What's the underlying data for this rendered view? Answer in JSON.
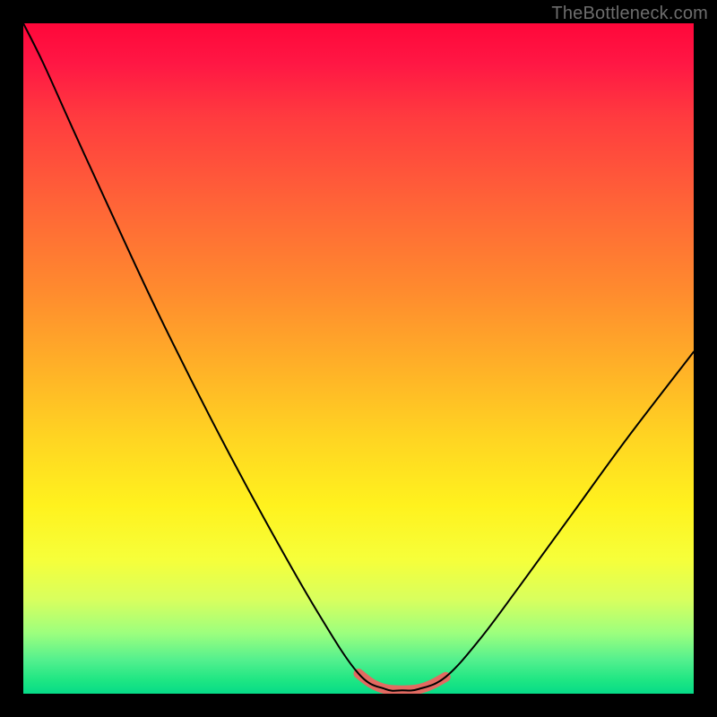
{
  "watermark": "TheBottleneck.com",
  "chart_data": {
    "type": "line",
    "title": "",
    "xlabel": "",
    "ylabel": "",
    "xlim": [
      0,
      100
    ],
    "ylim": [
      0,
      100
    ],
    "background_gradient": {
      "direction": "vertical",
      "stops": [
        {
          "pos": 0,
          "color": "#ff073a"
        },
        {
          "pos": 50,
          "color": "#ffb327"
        },
        {
          "pos": 75,
          "color": "#fff21e"
        },
        {
          "pos": 95,
          "color": "#53f08e"
        },
        {
          "pos": 100,
          "color": "#06db88"
        }
      ]
    },
    "series": [
      {
        "name": "bottleneck-curve",
        "color": "#000000",
        "width": 2,
        "x": [
          0.0,
          3.0,
          7.5,
          13.0,
          20.0,
          28.0,
          36.0,
          44.0,
          50.0,
          54.0,
          56.5,
          59.0,
          63.0,
          68.0,
          74.0,
          82.0,
          90.0,
          100.0
        ],
        "y": [
          100.0,
          94.0,
          84.0,
          72.0,
          57.0,
          41.0,
          26.0,
          12.0,
          3.0,
          0.7,
          0.5,
          0.7,
          2.5,
          8.0,
          16.0,
          27.0,
          38.0,
          51.0
        ]
      },
      {
        "name": "highlight-zone",
        "color": "#e26a61",
        "width": 11,
        "x": [
          50.0,
          52.0,
          54.0,
          56.5,
          59.0,
          61.0,
          63.0
        ],
        "y": [
          3.0,
          1.5,
          0.7,
          0.5,
          0.7,
          1.4,
          2.5
        ]
      }
    ]
  }
}
